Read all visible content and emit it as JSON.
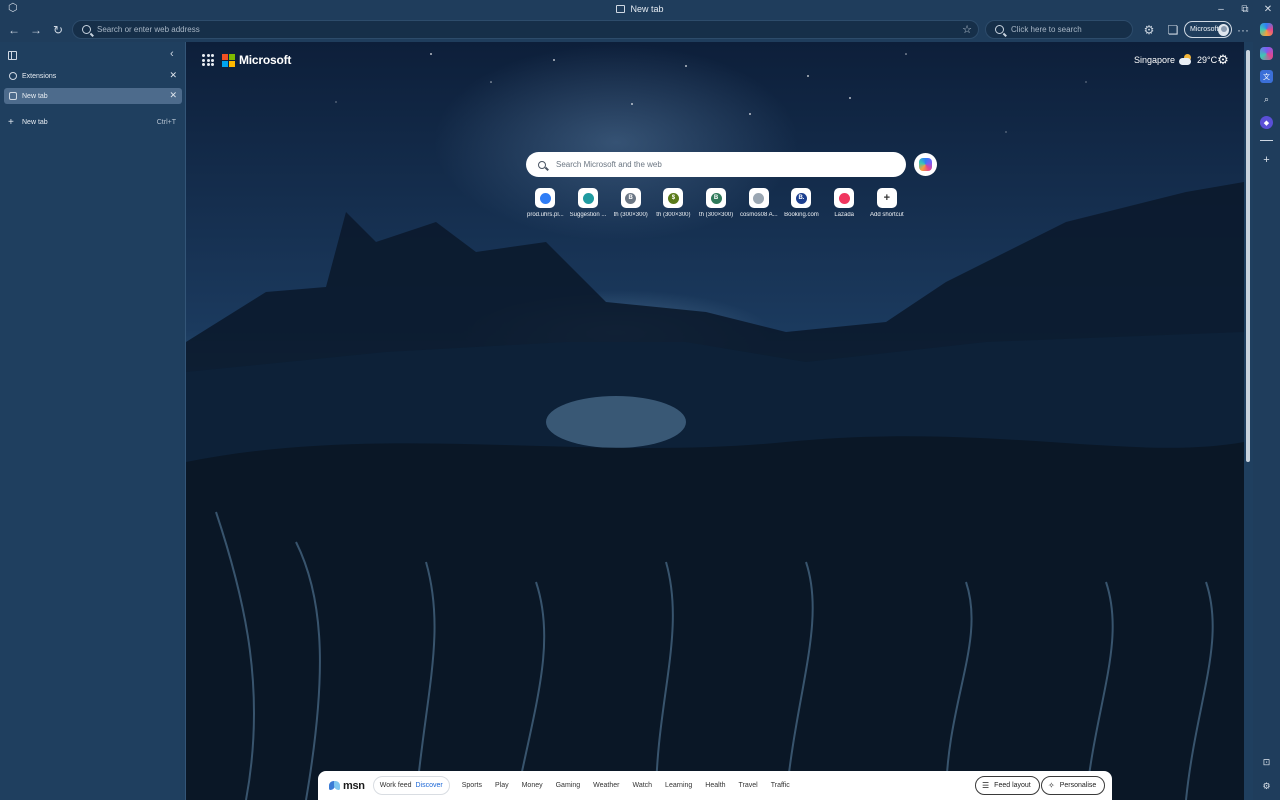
{
  "window": {
    "title": "New tab"
  },
  "toolbar": {
    "address_placeholder": "Search or enter web address",
    "bing_placeholder": "Click here to search",
    "profile_label": "Microsoft"
  },
  "vertical_tabs": {
    "tabs": [
      {
        "label": "Extensions",
        "active": false
      },
      {
        "label": "New tab",
        "active": true
      }
    ],
    "new_tab_label": "New tab",
    "new_tab_shortcut": "Ctrl+T"
  },
  "newtab": {
    "brand": "Microsoft",
    "weather": {
      "city": "Singapore",
      "temp": "29°C"
    },
    "search_placeholder": "Search Microsoft and the web",
    "shortcuts": [
      {
        "label": "prod.uhrs.pl...",
        "color": "#2f7df6",
        "glyph": ""
      },
      {
        "label": "Suggestion ...",
        "color": "#1f9aa0",
        "glyph": ""
      },
      {
        "label": "th (300×300)",
        "color": "#6b7785",
        "glyph": "B"
      },
      {
        "label": "th (300×300)",
        "color": "#5a7a1a",
        "glyph": "$"
      },
      {
        "label": "th (300×300)",
        "color": "#2f7a5a",
        "glyph": "B"
      },
      {
        "label": "cosmos08 A...",
        "color": "#9aa6b2",
        "glyph": ""
      },
      {
        "label": "Booking.com",
        "color": "#1c3f8f",
        "glyph": "B."
      },
      {
        "label": "Lazada",
        "color": "#f0365f",
        "glyph": ""
      },
      {
        "label": "Add shortcut",
        "color": "#ffffff",
        "glyph": "+"
      }
    ]
  },
  "msn": {
    "logo": "msn",
    "feed_tabs": [
      "Work feed",
      "Discover"
    ],
    "categories": [
      "Sports",
      "Play",
      "Money",
      "Gaming",
      "Weather",
      "Watch",
      "Learning",
      "Health",
      "Travel",
      "Traffic"
    ],
    "feed_layout_label": "Feed layout",
    "personalise_label": "Personalise"
  },
  "colors": {
    "accent": "#1a66d6",
    "chrome": "#1f3d5c"
  }
}
